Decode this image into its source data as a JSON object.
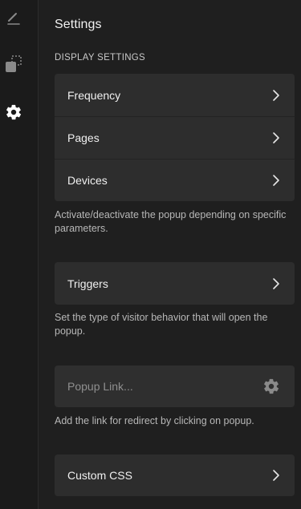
{
  "sidebar": {
    "icons": [
      {
        "name": "pencil-icon"
      },
      {
        "name": "layers-icon"
      },
      {
        "name": "gear-icon",
        "active": true
      }
    ]
  },
  "header": {
    "title": "Settings"
  },
  "display_settings": {
    "label": "DISPLAY SETTINGS",
    "items": [
      {
        "label": "Frequency"
      },
      {
        "label": "Pages"
      },
      {
        "label": "Devices"
      }
    ],
    "help": "Activate/deactivate the popup depending on specific parameters."
  },
  "triggers": {
    "label": "Triggers",
    "help": "Set the type of visitor behavior that will open the popup."
  },
  "popup_link": {
    "placeholder": "Popup Link...",
    "value": "",
    "help": "Add the link for redirect by clicking on popup."
  },
  "custom_css": {
    "label": "Custom CSS"
  },
  "colors": {
    "background": "#1f1f1f",
    "card": "#2d2d2d",
    "text": "#f0f0f0",
    "muted_text": "#b7b7b7",
    "icon_muted": "#8a8a8a",
    "icon_active": "#ffffff"
  }
}
